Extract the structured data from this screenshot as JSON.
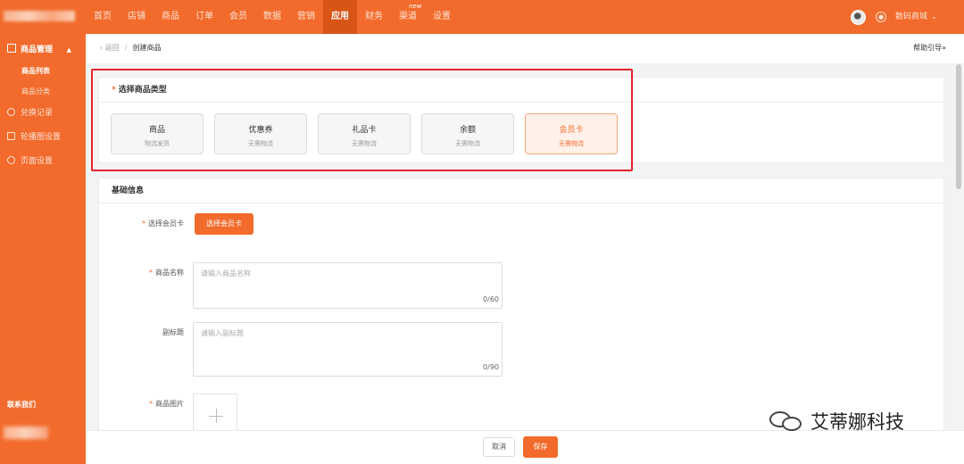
{
  "nav": {
    "items": [
      "首页",
      "店铺",
      "商品",
      "订单",
      "会员",
      "数据",
      "营销",
      "应用",
      "财务",
      "渠道",
      "设置"
    ],
    "badge": "new",
    "store": "数码商城"
  },
  "sidebar": {
    "group": "商品管理",
    "sub_items": [
      "商品列表",
      "商品分类"
    ],
    "items": [
      "兑换记录",
      "轮播图设置",
      "页面设置"
    ],
    "contact": "联系我们"
  },
  "breadcrumb": {
    "back": "返回",
    "current": "创建商品",
    "help": "帮助引导"
  },
  "type_section": {
    "title": "选择商品类型",
    "types": [
      {
        "name": "商品",
        "desc": "物流发货"
      },
      {
        "name": "优惠券",
        "desc": "无需物流"
      },
      {
        "name": "礼品卡",
        "desc": "无需物流"
      },
      {
        "name": "余额",
        "desc": "无需物流"
      },
      {
        "name": "会员卡",
        "desc": "无需物流"
      }
    ],
    "selected": "会员卡"
  },
  "basic": {
    "title": "基础信息",
    "card_label": "选择会员卡",
    "card_button": "选择会员卡",
    "name_label": "商品名称",
    "name_placeholder": "请输入商品名称",
    "name_count": "0/60",
    "subtitle_label": "副标题",
    "subtitle_placeholder": "请输入副标题",
    "subtitle_count": "0/90",
    "image_label": "商品图片"
  },
  "footer": {
    "cancel": "取消",
    "save": "保存"
  },
  "watermark": "艾蒂娜科技",
  "colors": {
    "brand": "#f26b2c",
    "highlight": "#e5232e"
  }
}
